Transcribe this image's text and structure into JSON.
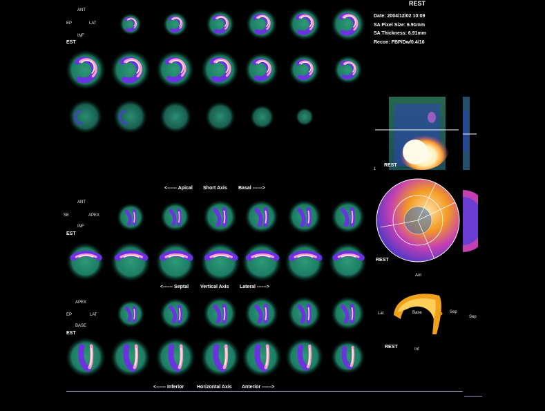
{
  "header": {
    "title": "REST",
    "date": "Date: 2004/12/02 10:09",
    "pixel_size": "SA Pixel Size: 6.91mm",
    "thickness": "SA Thickness: 6.91mm",
    "recon": "Recon: FBP/Dw/0.4/10"
  },
  "orient_sa": {
    "ant": "ANT",
    "ep": "EP",
    "lat": "LAT",
    "inf": "INF",
    "est": "EST"
  },
  "orient_va": {
    "ant": "ANT",
    "se": "SE",
    "apex": "APEX",
    "inf": "INF",
    "est": "EST"
  },
  "orient_ha": {
    "apex": "APEX",
    "ep": "EP",
    "lat": "LAT",
    "base": "BASE",
    "est": "EST"
  },
  "axes": {
    "short": {
      "left": "<------ Apical",
      "mid": "Short Axis",
      "right": "Basal ------>"
    },
    "vertical": {
      "left": "<------ Septal",
      "mid": "Vertical Axis",
      "right": "Lateral ------>"
    },
    "horizontal": {
      "left": "<------ Inferior",
      "mid": "Horizontal Axis",
      "right": "Anterior ------>"
    }
  },
  "right_panel": {
    "projection_label": "REST",
    "projection_index": "1",
    "polar_label": "REST",
    "polar_bottom": "Ant",
    "surface_label": "REST",
    "surface_lat": "Lat",
    "surface_base": "Base",
    "surface_sep": "Sep",
    "surface_inf": "Inf",
    "surface_sep_far": "Sep"
  },
  "colors": {
    "background": "#000000",
    "tissue_low": "#1f8a6d",
    "tissue_mid": "#5a2fd8",
    "tissue_high": "#ffe6b0",
    "polar_hot": "#f39a24"
  }
}
